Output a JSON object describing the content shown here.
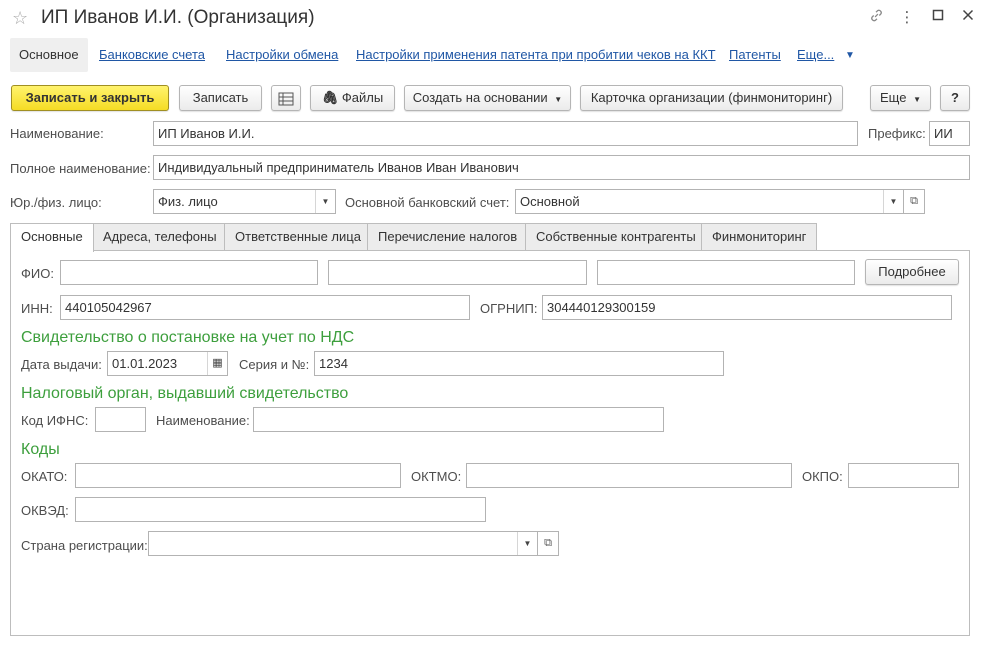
{
  "window": {
    "title": "ИП Иванов И.И. (Организация)",
    "icons": {
      "favorite": "star-icon",
      "link": "link-icon",
      "menu": "more-vertical-icon",
      "maximize": "maximize-icon",
      "close": "close-icon"
    }
  },
  "nav": {
    "active": "Основное",
    "links": [
      "Банковские счета",
      "Настройки обмена",
      "Настройки применения патента при пробитии чеков на ККТ",
      "Патенты",
      "Еще..."
    ]
  },
  "toolbar": {
    "save_close": "Записать и закрыть",
    "save": "Записать",
    "files": "Файлы",
    "create_based": "Создать на основании",
    "card": "Карточка организации (финмониторинг)",
    "more": "Еще",
    "help": "?"
  },
  "header_fields": {
    "name_label": "Наименование:",
    "name_value": "ИП Иванов И.И.",
    "prefix_label": "Префикс:",
    "prefix_value": "ИИ",
    "full_name_label": "Полное наименование:",
    "full_name_value": "Индивидуальный предприниматель Иванов Иван Иванович",
    "legal_type_label": "Юр./физ. лицо:",
    "legal_type_value": "Физ. лицо",
    "bank_account_label": "Основной банковский счет:",
    "bank_account_value": "Основной"
  },
  "tabs": [
    "Основные",
    "Адреса, телефоны",
    "Ответственные лица",
    "Перечисление налогов",
    "Собственные контрагенты",
    "Финмониторинг"
  ],
  "main": {
    "fio_label": "ФИО:",
    "fio_values": [
      "",
      "",
      ""
    ],
    "details_button": "Подробнее",
    "inn_label": "ИНН:",
    "inn_value": "440105042967",
    "ogrnip_label": "ОГРНИП:",
    "ogrnip_value": "304440129300159",
    "vat_section": "Свидетельство о постановке на учет по НДС",
    "issue_date_label": "Дата выдачи:",
    "issue_date_value": "01.01.2023",
    "series_label": "Серия и №:",
    "series_value": "1234",
    "tax_section": "Налоговый орган, выдавший свидетельство",
    "ifns_code_label": "Код ИФНС:",
    "ifns_code_value": "",
    "ifns_name_label": "Наименование:",
    "ifns_name_value": "",
    "codes_section": "Коды",
    "okato_label": "ОКАТО:",
    "okato_value": "",
    "oktmo_label": "ОКТМО:",
    "oktmo_value": "",
    "okpo_label": "ОКПО:",
    "okpo_value": "",
    "okved_label": "ОКВЭД:",
    "okved_value": "",
    "country_label": "Страна регистрации:",
    "country_value": ""
  },
  "colors": {
    "primary_button": "#f5dc24",
    "link": "#2057a5",
    "section_header": "#3d9f3d"
  }
}
